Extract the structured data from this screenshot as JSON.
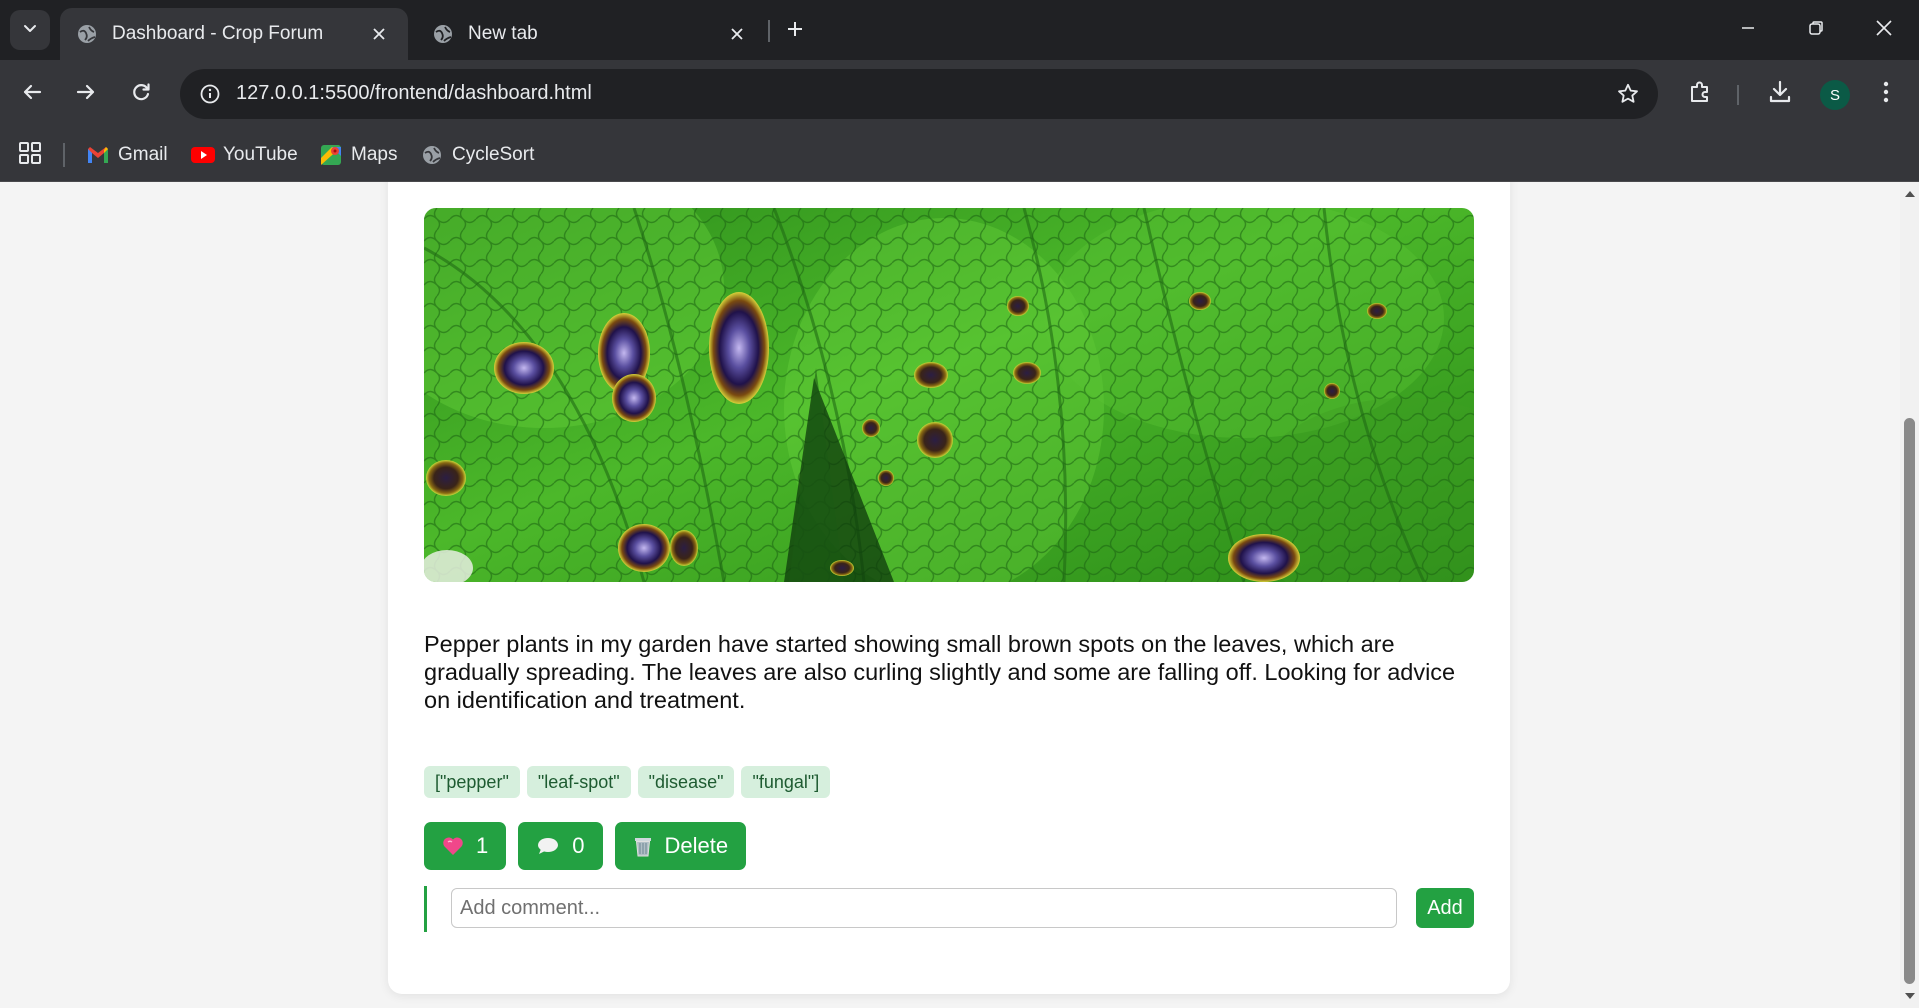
{
  "browser": {
    "tabs": [
      {
        "title": "Dashboard - Crop Forum",
        "active": true
      },
      {
        "title": "New tab",
        "active": false
      }
    ],
    "address": {
      "url": "127.0.0.1:5500/frontend/dashboard.html"
    },
    "profile_initial": "S",
    "bookmarks": [
      {
        "label": "Gmail",
        "icon": "gmail-icon"
      },
      {
        "label": "YouTube",
        "icon": "youtube-icon"
      },
      {
        "label": "Maps",
        "icon": "maps-icon"
      },
      {
        "label": "CycleSort",
        "icon": "globe-icon"
      }
    ]
  },
  "post": {
    "image": {
      "subject": "pepper-leaf-spot",
      "alt_icon": "leaf-photo"
    },
    "text": "Pepper plants in my garden have started showing small brown spots on the leaves, which are gradually spreading. The leaves are also curling slightly and some are falling off. Looking for advice on identification and treatment.",
    "tags": [
      "[\"pepper\"",
      "\"leaf-spot\"",
      "\"disease\"",
      "\"fungal\"]"
    ],
    "actions": {
      "like": {
        "emoji": "💗",
        "count": "1"
      },
      "comment": {
        "emoji": "💬",
        "count": "0"
      },
      "delete": {
        "emoji": "🗑",
        "label": "Delete"
      }
    },
    "comment_form": {
      "placeholder": "Add comment...",
      "value": "",
      "submit_label": "Add"
    }
  },
  "colors": {
    "accent_green": "#23a142",
    "tag_bg": "#d6efdd",
    "tag_text": "#1e5b31",
    "chrome_dark": "#202124",
    "chrome_toolbar": "#35363a"
  }
}
